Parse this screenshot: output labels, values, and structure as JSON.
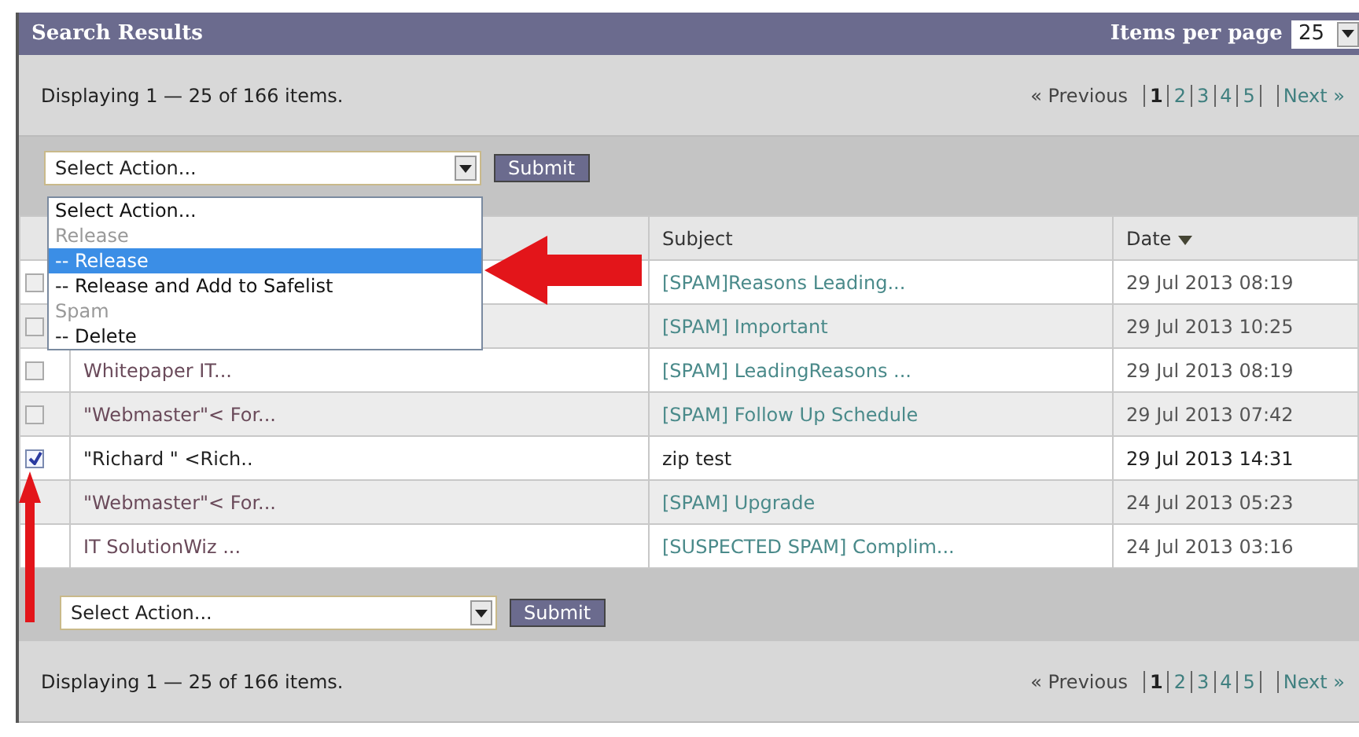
{
  "panel": {
    "title": "Search Results",
    "items_per_page_label": "Items per page",
    "items_per_page": "25"
  },
  "pager_top": {
    "summary": "Displaying 1 — 25 of 166 items.",
    "previous": "« Previous",
    "pages": [
      {
        "label": "1",
        "selected": true
      },
      {
        "label": "2",
        "selected": false
      },
      {
        "label": "3",
        "selected": false
      },
      {
        "label": "4",
        "selected": false
      },
      {
        "label": "5",
        "selected": false
      }
    ],
    "next": "Next »"
  },
  "action_top": {
    "value": "Select Action...",
    "submit": "Submit"
  },
  "action_menu": [
    {
      "kind": "option",
      "label": "Select Action...",
      "selected": false
    },
    {
      "kind": "group",
      "label": "Release"
    },
    {
      "kind": "option",
      "label": "-- Release",
      "selected": true
    },
    {
      "kind": "option",
      "label": "-- Release and Add to Safelist",
      "selected": false
    },
    {
      "kind": "group",
      "label": "Spam"
    },
    {
      "kind": "option",
      "label": "-- Delete",
      "selected": false
    }
  ],
  "table": {
    "columns": [
      "Subject",
      "Date"
    ],
    "rows": [
      {
        "checked": false,
        "subject": "[SPAM]Reasons Leading...",
        "date": "29 Jul 2013 08:19"
      },
      {
        "checked": false,
        "subject": "[SPAM] Important",
        "date": "29 Jul 2013 10:25"
      },
      {
        "checked": false,
        "sender": "Whitepaper IT...",
        "subject": "[SPAM] LeadingReasons ...",
        "date": "29 Jul 2013 08:19"
      },
      {
        "checked": false,
        "sender": "\"Webmaster\"< For...",
        "subject": "[SPAM] Follow Up Schedule",
        "date": "29 Jul 2013 07:42"
      },
      {
        "checked": true,
        "sender": "\"Richard  \" <Rich..",
        "subject": "zip test",
        "date": "29 Jul 2013 14:31",
        "plain": true
      },
      {
        "sender": "\"Webmaster\"< For...",
        "subject": "[SPAM] Upgrade",
        "date": "24 Jul 2013 05:23"
      },
      {
        "sender": "IT SolutionWiz ...",
        "subject": "[SUSPECTED SPAM] Complim...",
        "date": "24 Jul 2013 03:16"
      }
    ]
  },
  "action_bottom": {
    "value": "Select Action...",
    "submit": "Submit"
  },
  "pager_bottom": {
    "summary": "Displaying 1 — 25 of 166 items.",
    "previous": "« Previous",
    "pages": [
      {
        "label": "1",
        "selected": true
      },
      {
        "label": "2",
        "selected": false
      },
      {
        "label": "3",
        "selected": false
      },
      {
        "label": "4",
        "selected": false
      },
      {
        "label": "5",
        "selected": false
      }
    ],
    "next": "Next »"
  }
}
